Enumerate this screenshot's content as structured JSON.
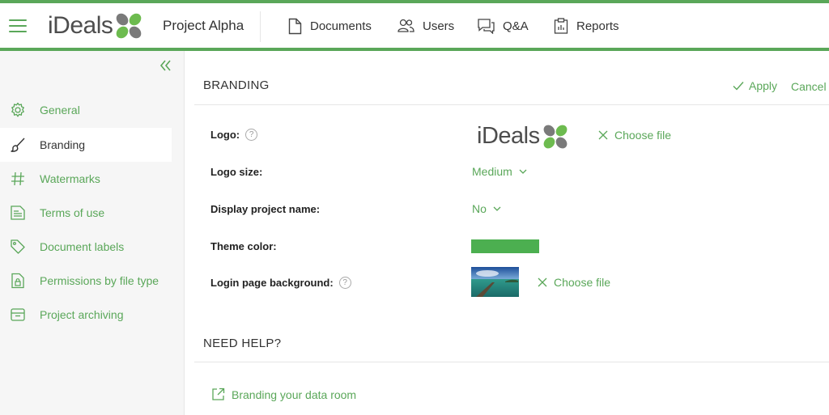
{
  "header": {
    "logo_text": "iDeals",
    "project_name": "Project Alpha",
    "nav": [
      {
        "label": "Documents",
        "icon": "document-icon"
      },
      {
        "label": "Users",
        "icon": "users-icon"
      },
      {
        "label": "Q&A",
        "icon": "chat-icon"
      },
      {
        "label": "Reports",
        "icon": "clipboard-icon"
      }
    ]
  },
  "sidebar": {
    "items": [
      {
        "label": "General",
        "icon": "gear-icon"
      },
      {
        "label": "Branding",
        "icon": "brush-icon",
        "active": true
      },
      {
        "label": "Watermarks",
        "icon": "hash-icon"
      },
      {
        "label": "Terms of use",
        "icon": "terms-icon"
      },
      {
        "label": "Document labels",
        "icon": "tag-icon"
      },
      {
        "label": "Permissions by file type",
        "icon": "file-lock-icon"
      },
      {
        "label": "Project archiving",
        "icon": "archive-icon"
      }
    ]
  },
  "branding": {
    "title": "BRANDING",
    "apply_label": "Apply",
    "cancel_label": "Cancel",
    "logo_label": "Logo:",
    "logo_preview_text": "iDeals",
    "choose_file_label": "Choose file",
    "logo_size_label": "Logo size:",
    "logo_size_value": "Medium",
    "display_name_label": "Display project name:",
    "display_name_value": "No",
    "theme_color_label": "Theme color:",
    "theme_color": "#4caf50",
    "login_bg_label": "Login page background:",
    "login_bg_choose_label": "Choose file",
    "help_mark": "?"
  },
  "help": {
    "title": "NEED HELP?",
    "link_label": "Branding your data room"
  },
  "colors": {
    "accent": "#5aa759",
    "logo_green": "#6dbb4f",
    "logo_grey": "#7a7a7a"
  }
}
